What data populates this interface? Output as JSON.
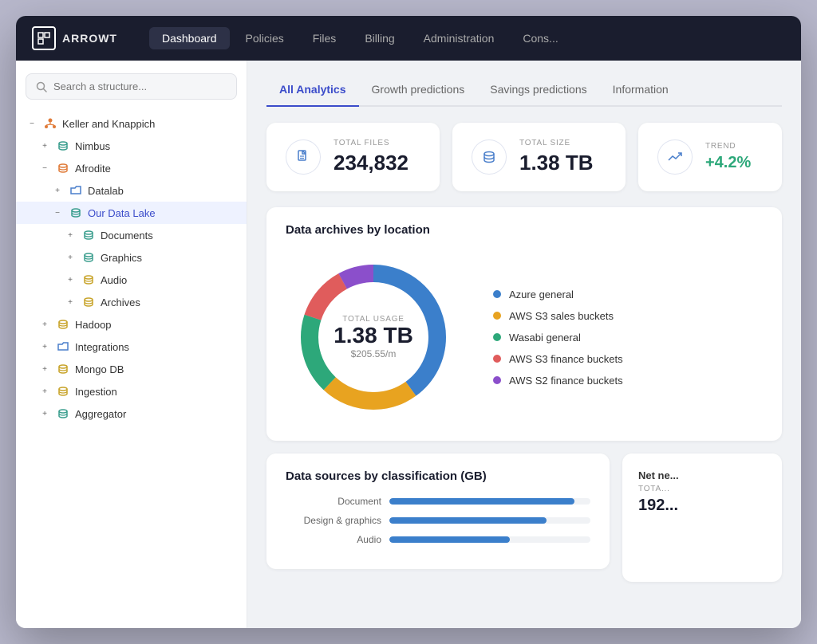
{
  "app": {
    "logo_text": "ARROWT",
    "nav": {
      "items": [
        {
          "label": "Dashboard",
          "active": true
        },
        {
          "label": "Policies"
        },
        {
          "label": "Files"
        },
        {
          "label": "Billing"
        },
        {
          "label": "Administration"
        },
        {
          "label": "Cons..."
        }
      ]
    }
  },
  "sidebar": {
    "search_placeholder": "Search a structure...",
    "tree": [
      {
        "id": "keller",
        "label": "Keller and Knappich",
        "icon": "org",
        "indent": 0,
        "toggle": "minus"
      },
      {
        "id": "nimbus",
        "label": "Nimbus",
        "icon": "db-teal",
        "indent": 1,
        "toggle": "plus"
      },
      {
        "id": "afrodite",
        "label": "Afrodite",
        "icon": "db-orange",
        "indent": 1,
        "toggle": "minus"
      },
      {
        "id": "datalab",
        "label": "Datalab",
        "icon": "folder-blue",
        "indent": 2,
        "toggle": "plus"
      },
      {
        "id": "our-data-lake",
        "label": "Our Data Lake",
        "icon": "db-teal",
        "indent": 2,
        "toggle": "minus",
        "active": true
      },
      {
        "id": "documents",
        "label": "Documents",
        "icon": "db-teal",
        "indent": 3,
        "toggle": "plus"
      },
      {
        "id": "graphics",
        "label": "Graphics",
        "icon": "db-teal",
        "indent": 3,
        "toggle": "plus"
      },
      {
        "id": "audio",
        "label": "Audio",
        "icon": "db-gold",
        "indent": 3,
        "toggle": "plus"
      },
      {
        "id": "archives",
        "label": "Archives",
        "icon": "db-gold",
        "indent": 3,
        "toggle": "plus"
      },
      {
        "id": "hadoop",
        "label": "Hadoop",
        "icon": "db-gold",
        "indent": 1,
        "toggle": "plus"
      },
      {
        "id": "integrations",
        "label": "Integrations",
        "icon": "folder-blue",
        "indent": 1,
        "toggle": "plus"
      },
      {
        "id": "mongo-db",
        "label": "Mongo DB",
        "icon": "db-gold",
        "indent": 1,
        "toggle": "plus"
      },
      {
        "id": "ingestion",
        "label": "Ingestion",
        "icon": "db-gold",
        "indent": 1,
        "toggle": "plus"
      },
      {
        "id": "aggregator",
        "label": "Aggregator",
        "icon": "db-teal",
        "indent": 1,
        "toggle": "plus"
      }
    ]
  },
  "content": {
    "tabs": [
      {
        "label": "All Analytics",
        "active": true
      },
      {
        "label": "Growth predictions"
      },
      {
        "label": "Savings predictions"
      },
      {
        "label": "Information"
      }
    ],
    "stats": [
      {
        "label": "TOTAL FILES",
        "value": "234,832",
        "icon": "file"
      },
      {
        "label": "TOTAL SIZE",
        "value": "1.38 TB",
        "icon": "database"
      },
      {
        "label": "TREND",
        "value": "+4.2%",
        "icon": "trend"
      }
    ],
    "donut_chart": {
      "title": "Data archives by location",
      "total_label": "TOTAL USAGE",
      "total_value": "1.38 TB",
      "total_sub": "$205.55/m",
      "segments": [
        {
          "label": "Azure general",
          "color": "#3b7fcb",
          "pct": 40
        },
        {
          "label": "AWS S3 sales buckets",
          "color": "#e8a320",
          "pct": 22
        },
        {
          "label": "Wasabi general",
          "color": "#2da87a",
          "pct": 18
        },
        {
          "label": "AWS S3 finance buckets",
          "color": "#e05c5c",
          "pct": 12
        },
        {
          "label": "AWS S2 finance buckets",
          "color": "#8b4fcb",
          "pct": 8
        }
      ]
    },
    "bar_chart": {
      "title": "Data sources by classification (GB)",
      "bars": [
        {
          "label": "Document",
          "pct": 92,
          "color": "#3b7fcb"
        },
        {
          "label": "Design & graphics",
          "pct": 78,
          "color": "#3b7fcb"
        },
        {
          "label": "Audio",
          "pct": 60,
          "color": "#3b7fcb"
        }
      ]
    },
    "net": {
      "title": "Net ne...",
      "total_label": "TOTA...",
      "value": "192..."
    }
  }
}
